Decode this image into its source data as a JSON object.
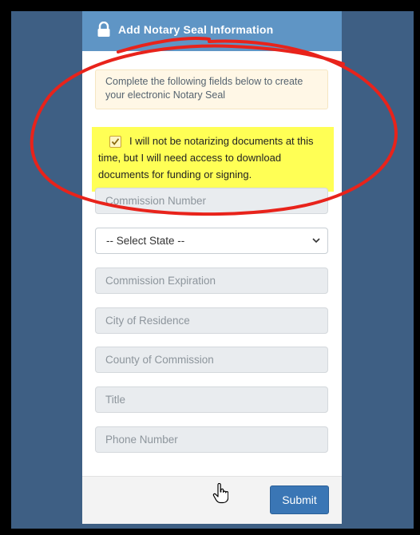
{
  "header": {
    "title": "Add Notary Seal Information",
    "icon": "lock-icon"
  },
  "info_message": "Complete the following fields below to create your electronic Notary Seal",
  "checkbox": {
    "checked": true,
    "label": "I will not be notarizing documents at this time, but I will need access to download documents for funding or signing."
  },
  "fields": {
    "commission_number": "Commission Number",
    "state_selected": "-- Select State --",
    "commission_expiration": "Commission Expiration",
    "city_of_residence": "City of Residence",
    "county_of_commission": "County of Commission",
    "title": "Title",
    "phone_number": "Phone Number"
  },
  "submit_label": "Submit",
  "colors": {
    "header": "#5f95c5",
    "background": "#3e5f84",
    "highlight": "#ffff55",
    "annotation": "#e8231b",
    "button": "#3a76b5"
  }
}
